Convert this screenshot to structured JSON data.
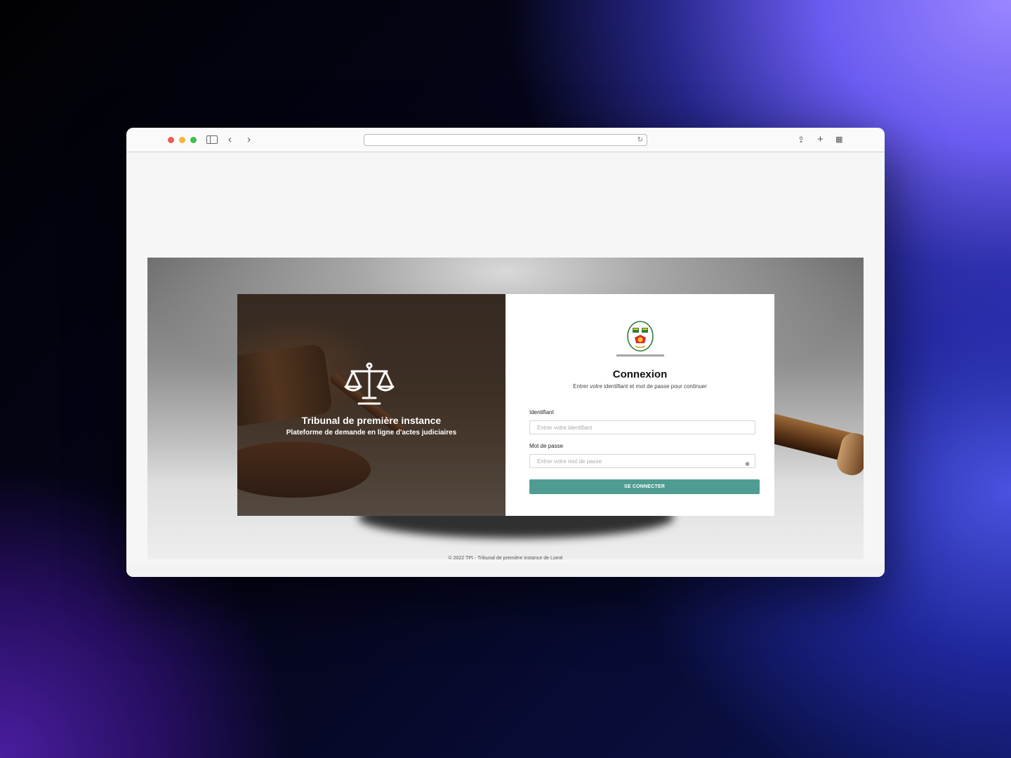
{
  "browser": {
    "address": "",
    "reload_icon": "reload-icon",
    "icons": [
      "sidebar-icon",
      "back-icon",
      "forward-icon",
      "share-icon",
      "new-tab-icon",
      "tab-overview-icon"
    ],
    "back_glyph": "‹",
    "forward_glyph": "›",
    "share_glyph": "⇪",
    "new_tab_glyph": "+",
    "tabs_glyph": "▦"
  },
  "left_panel": {
    "title": "Tribunal de première instance",
    "subtitle": "Plateforme de demande en ligne d'actes judiciaires",
    "icon": "scales-of-justice-icon"
  },
  "login": {
    "logo": "emblem-logo",
    "title": "Connexion",
    "subtitle": "Entrer votre identifiant et mot de passe pour continuer",
    "username_label": "Identifiant",
    "username_placeholder": "Entrer votre identifiant",
    "password_label": "Mot de passe",
    "password_placeholder": "Entrer votre mot de passe",
    "password_toggle_icon": "eye-icon",
    "submit_label": "SE CONNECTER"
  },
  "footer": {
    "text": "© 2022 TPI - Tribunal de première instance de Lomé"
  },
  "colors": {
    "accent": "#4f9d92",
    "panel_overlay": "#3e3127"
  }
}
